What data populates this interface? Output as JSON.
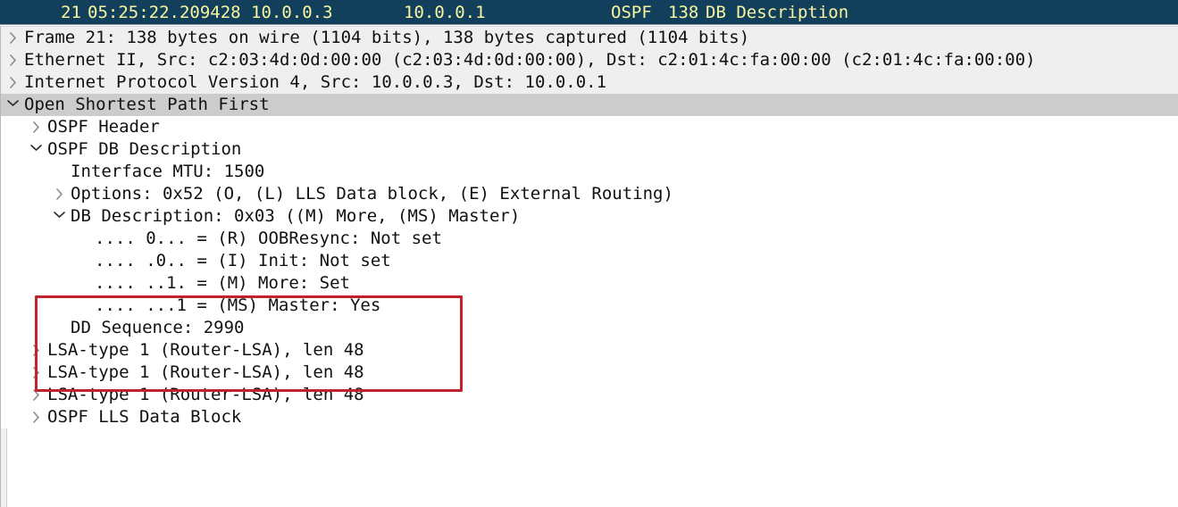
{
  "packet_summary": {
    "no": "21",
    "time": "05:25:22.209428",
    "source": "10.0.0.3",
    "destination": "10.0.0.1",
    "protocol": "OSPF",
    "length": "138",
    "info": "DB Description",
    "background_color": "#12405c",
    "text_color": "#f7f5a0"
  },
  "colors": {
    "annotation_red": "#c0232b",
    "selected_row": "#cccccc",
    "alt_row": "#efefef",
    "pane_background": "#ffffff"
  },
  "detail_tree": {
    "rows": [
      {
        "indent": 0,
        "twisty": "collapsed",
        "text": "Frame 21: 138 bytes on wire (1104 bits), 138 bytes captured (1104 bits)",
        "bg": "alt"
      },
      {
        "indent": 0,
        "twisty": "collapsed",
        "text": "Ethernet II, Src: c2:03:4d:0d:00:00 (c2:03:4d:0d:00:00), Dst: c2:01:4c:fa:00:00 (c2:01:4c:fa:00:00)",
        "bg": "alt"
      },
      {
        "indent": 0,
        "twisty": "collapsed",
        "text": "Internet Protocol Version 4, Src: 10.0.0.3, Dst: 10.0.0.1",
        "bg": "alt"
      },
      {
        "indent": 0,
        "twisty": "expanded",
        "text": "Open Shortest Path First",
        "bg": "selected"
      },
      {
        "indent": 1,
        "twisty": "collapsed",
        "text": "OSPF Header",
        "bg": "white"
      },
      {
        "indent": 1,
        "twisty": "expanded",
        "text": "OSPF DB Description",
        "bg": "white"
      },
      {
        "indent": 2,
        "twisty": "none",
        "text": "Interface MTU: 1500",
        "bg": "white"
      },
      {
        "indent": 2,
        "twisty": "collapsed",
        "text": "Options: 0x52 (O, (L) LLS Data block, (E) External Routing)",
        "bg": "white"
      },
      {
        "indent": 2,
        "twisty": "expanded",
        "text": "DB Description: 0x03 ((M) More, (MS) Master)",
        "bg": "white"
      },
      {
        "indent": 3,
        "twisty": "none",
        "text": ".... 0... = (R) OOBResync: Not set",
        "bg": "white"
      },
      {
        "indent": 3,
        "twisty": "none",
        "text": ".... .0.. = (I) Init: Not set",
        "bg": "white"
      },
      {
        "indent": 3,
        "twisty": "none",
        "text": ".... ..1. = (M) More: Set",
        "bg": "white"
      },
      {
        "indent": 3,
        "twisty": "none",
        "text": ".... ...1 = (MS) Master: Yes",
        "bg": "white"
      },
      {
        "indent": 2,
        "twisty": "none",
        "text": "DD Sequence: 2990",
        "bg": "white"
      },
      {
        "indent": 1,
        "twisty": "collapsed",
        "text": "LSA-type 1 (Router-LSA), len 48",
        "bg": "white"
      },
      {
        "indent": 1,
        "twisty": "collapsed",
        "text": "LSA-type 1 (Router-LSA), len 48",
        "bg": "white"
      },
      {
        "indent": 1,
        "twisty": "collapsed",
        "text": "LSA-type 1 (Router-LSA), len 48",
        "bg": "white"
      },
      {
        "indent": 1,
        "twisty": "collapsed",
        "text": "OSPF LLS Data Block",
        "bg": "white"
      }
    ]
  },
  "annotation": {
    "shape": "rectangle",
    "color": "#c0232b",
    "highlighted_rows": [
      ".... .0.. = (I) Init: Not set",
      ".... ..1. = (M) More: Set",
      ".... ...1 = (MS) Master: Yes",
      "DD Sequence: 2990"
    ]
  }
}
